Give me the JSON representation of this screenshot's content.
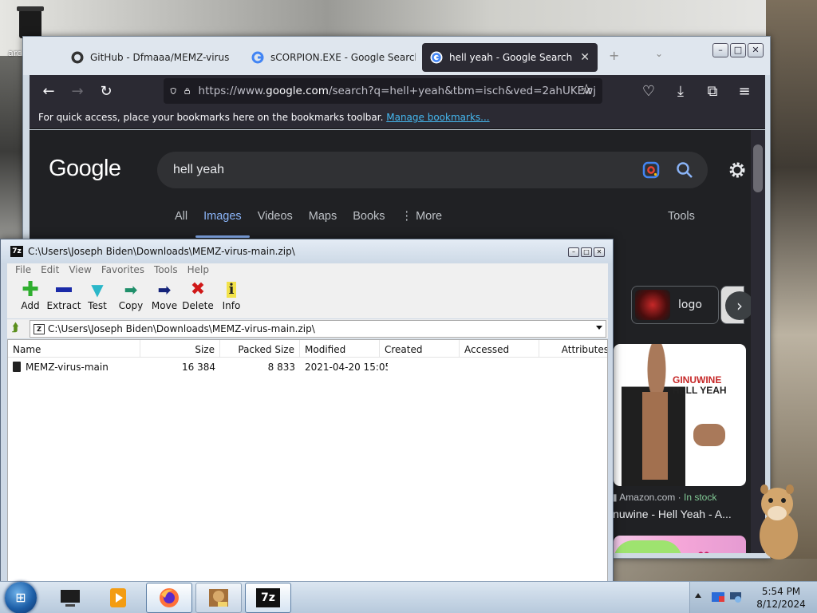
{
  "desktop": {
    "icon_label": "arc"
  },
  "browser": {
    "tabs": [
      {
        "title": "GitHub - Dfmaaa/MEMZ-virus",
        "icon": "github-icon"
      },
      {
        "title": "sCORPION.EXE - Google Search",
        "icon": "google-icon"
      },
      {
        "title": "hell yeah - Google Search",
        "icon": "google-icon",
        "active": true
      }
    ],
    "url_prefix": "https://www.",
    "url_host": "google.com",
    "url_rest": "/search?q=hell+yeah&tbm=isch&ved=2ahUKEwj",
    "bookmarks_text": "For quick access, place your bookmarks here on the bookmarks toolbar.",
    "bookmarks_link": "Manage bookmarks..."
  },
  "google": {
    "logo": "Google",
    "query": "hell yeah",
    "tabs": [
      "All",
      "Images",
      "Videos",
      "Maps",
      "Books",
      "More"
    ],
    "active_tab": "Images",
    "tools": "Tools",
    "chip_label": "logo",
    "result_overlay_line1": "GINUWINE",
    "result_overlay_line2": "HELL YEAH",
    "result_source": "Amazon.com",
    "result_stock": "In stock",
    "result_title": "inuwine - Hell Yeah - A..."
  },
  "sevenzip": {
    "title": "C:\\Users\\Joseph Biden\\Downloads\\MEMZ-virus-main.zip\\",
    "badge": "7z",
    "menu": [
      "File",
      "Edit",
      "View",
      "Favorites",
      "Tools",
      "Help"
    ],
    "toolbar": [
      {
        "label": "Add",
        "icon": "add-icon",
        "color": "#2fae2f"
      },
      {
        "label": "Extract",
        "icon": "extract-icon",
        "color": "#1a2aa8"
      },
      {
        "label": "Test",
        "icon": "test-icon",
        "color": "#2bb7c9"
      },
      {
        "label": "Copy",
        "icon": "copy-icon",
        "color": "#1f8f6a"
      },
      {
        "label": "Move",
        "icon": "move-icon",
        "color": "#14237a"
      },
      {
        "label": "Delete",
        "icon": "delete-icon",
        "color": "#d01818"
      },
      {
        "label": "Info",
        "icon": "info-icon",
        "color": "#d7c200"
      }
    ],
    "address": "C:\\Users\\Joseph Biden\\Downloads\\MEMZ-virus-main.zip\\",
    "columns": [
      "Name",
      "Size",
      "Packed Size",
      "Modified",
      "Created",
      "Accessed",
      "Attributes"
    ],
    "rows": [
      {
        "name": "MEMZ-virus-main",
        "size": "16 384",
        "packed": "8 833",
        "modified": "2021-04-20 15:05",
        "created": "",
        "accessed": "",
        "attributes": ""
      }
    ]
  },
  "taskbar": {
    "time": "5:54 PM",
    "date": "8/12/2024",
    "apps": [
      "media-icon",
      "firefox-icon",
      "sandbox-icon",
      "7zip-icon"
    ],
    "sevenzip_label": "7z"
  }
}
